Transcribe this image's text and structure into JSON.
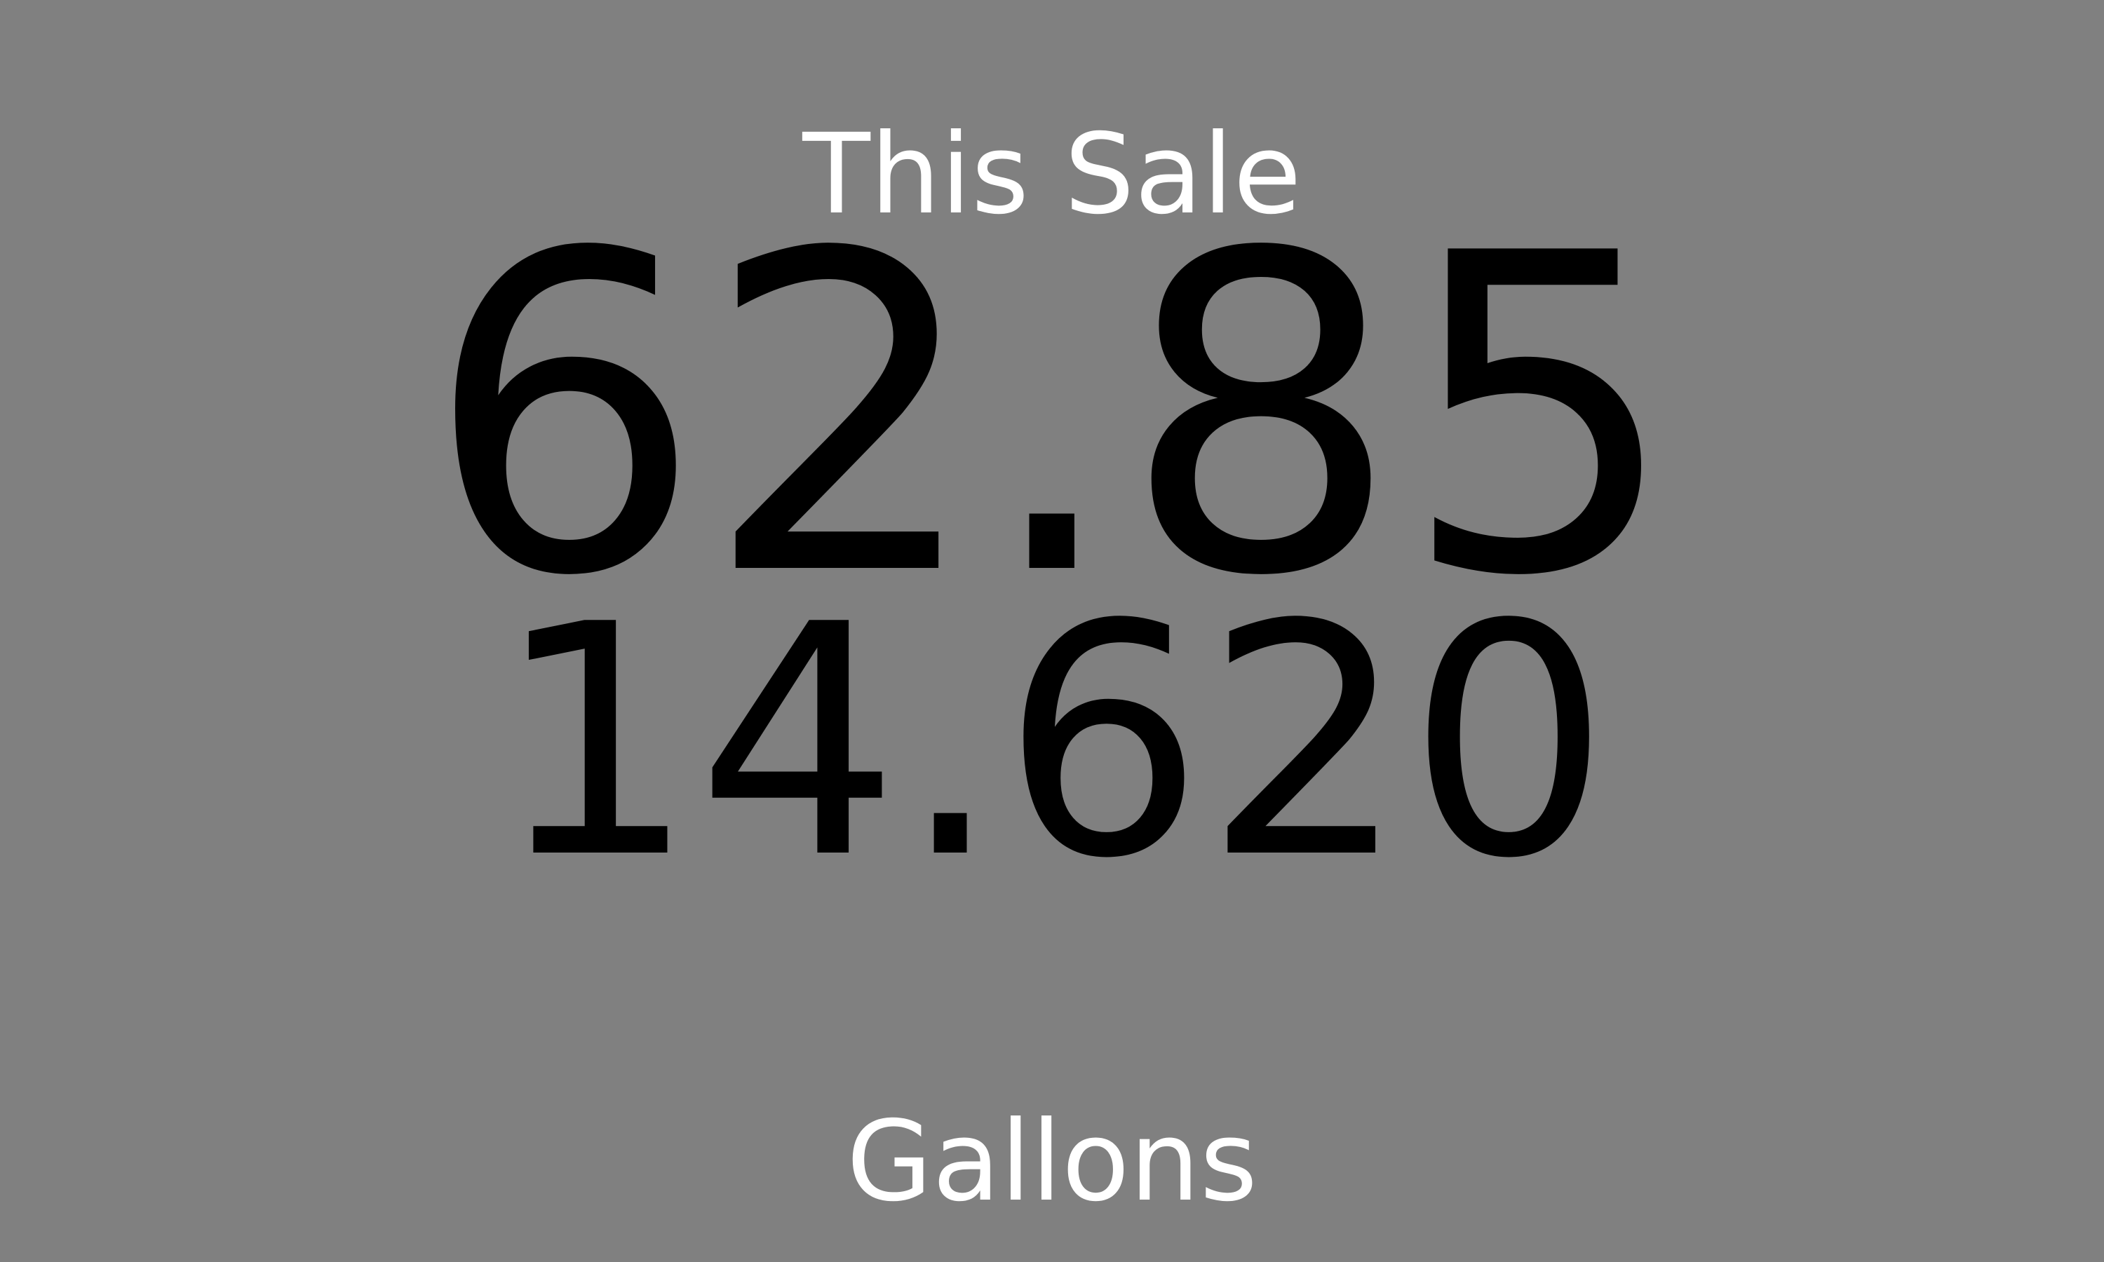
{
  "display": {
    "title": "This Sale",
    "sale_amount": "62.85",
    "gallons_amount": "14.620",
    "units_label": "Gallons"
  },
  "colors": {
    "background": "#808080",
    "label_text": "#ffffff",
    "value_text": "#000000"
  }
}
